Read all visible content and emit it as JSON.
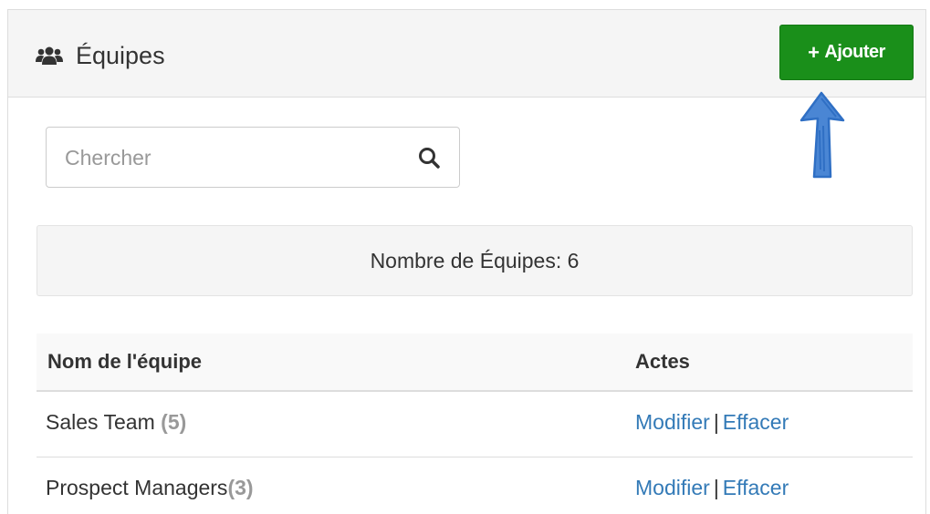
{
  "header": {
    "title": "Équipes",
    "title_icon": "users-icon",
    "add_button": {
      "icon": "plus-icon",
      "label": "Ajouter",
      "color": "#1a8f1a"
    }
  },
  "search": {
    "placeholder": "Chercher",
    "value": "",
    "icon": "search-icon"
  },
  "summary": {
    "text": "Nombre de Équipes: 6"
  },
  "table": {
    "columns": [
      "Nom de l'équipe",
      "Actes"
    ],
    "rows": [
      {
        "name": "Sales Team",
        "count": "(5)",
        "edit": "Modifier",
        "separator": "|",
        "delete": "Effacer"
      },
      {
        "name": "Prospect Managers",
        "count": "(3)",
        "edit": "Modifier",
        "separator": "|",
        "delete": "Effacer"
      }
    ]
  },
  "colors": {
    "link": "#337ab7",
    "annotation_arrow": "#2f6fc4"
  }
}
